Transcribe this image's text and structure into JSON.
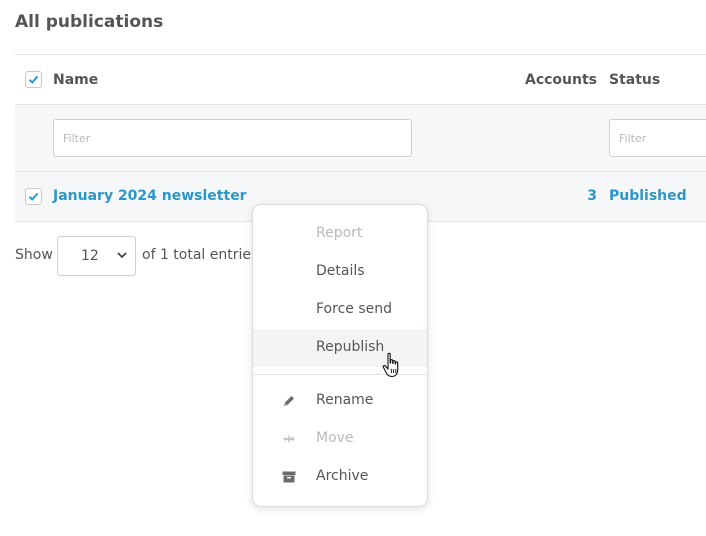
{
  "page": {
    "title": "All publications"
  },
  "table": {
    "columns": {
      "name": "Name",
      "accounts": "Accounts",
      "status": "Status"
    },
    "filters": {
      "name_placeholder": "Filter",
      "status_placeholder": "Filter"
    },
    "rows": [
      {
        "name": "January 2024 newsletter",
        "accounts": "3",
        "status": "Published",
        "checked": true
      }
    ]
  },
  "pagination": {
    "show_label": "Show",
    "page_size": "12",
    "entries_text": "of 1 total entries."
  },
  "context_menu": {
    "items": [
      {
        "label": "Report",
        "disabled": true
      },
      {
        "label": "Details"
      },
      {
        "label": "Force send"
      },
      {
        "label": "Republish",
        "hovered": true
      },
      {
        "label": "Rename",
        "icon": "pencil-icon"
      },
      {
        "label": "Move",
        "icon": "move-arrows-icon",
        "disabled": true
      },
      {
        "label": "Archive",
        "icon": "archive-box-icon"
      }
    ]
  },
  "colors": {
    "accent": "#2a97c9",
    "text": "#555555",
    "disabled": "#b9b9b9",
    "row_bg": "#f6f7f9"
  }
}
